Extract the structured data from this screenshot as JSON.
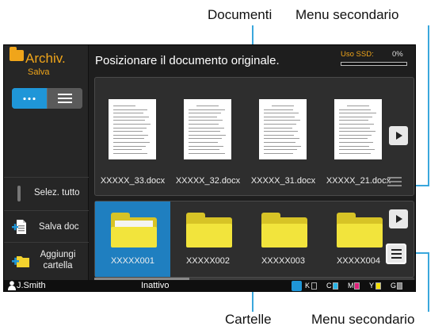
{
  "callouts": {
    "documents": "Documenti",
    "menu_top": "Menu secondario",
    "folders": "Cartelle",
    "menu_bottom": "Menu secondario"
  },
  "app": {
    "title": "Archiv.",
    "subtitle": "Salva",
    "accent_color": "#f0a51a",
    "selection_color": "#1f96d8"
  },
  "header": {
    "message": "Posizionare il documento originale.",
    "ssd_label": "Uso SSD:",
    "ssd_percent": "0%",
    "ssd_usage_fraction": 0
  },
  "sidebar": {
    "view_modes": [
      "grid-view",
      "list-view"
    ],
    "select_all": "Selez. tutto",
    "save_doc": "Salva doc",
    "add_folder": "Aggiungi cartella"
  },
  "documents": [
    {
      "name": "XXXXX_33.docx"
    },
    {
      "name": "XXXXX_32.docx"
    },
    {
      "name": "XXXXX_31.docx"
    },
    {
      "name": "XXXXX_21.docx"
    }
  ],
  "folders": [
    {
      "name": "XXXXX001",
      "selected": true
    },
    {
      "name": "XXXXX002",
      "selected": false
    },
    {
      "name": "XXXXX003",
      "selected": false
    },
    {
      "name": "XXXXX004",
      "selected": false
    }
  ],
  "status_bar": {
    "user": "J.Smith",
    "state": "Inattivo",
    "toner": [
      {
        "label": "K",
        "color": "#222222"
      },
      {
        "label": "C",
        "color": "#29b6e8"
      },
      {
        "label": "M",
        "color": "#e0207a"
      },
      {
        "label": "Y",
        "color": "#f5e000"
      },
      {
        "label": "G",
        "color": "#888888"
      }
    ]
  }
}
